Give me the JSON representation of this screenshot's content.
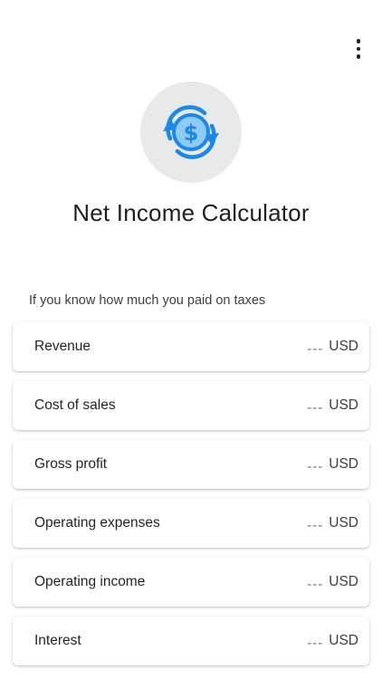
{
  "colors": {
    "accent": "#1e88e5",
    "accent_light": "#90caf9",
    "logo_background": "#e8e9ea"
  },
  "header": {
    "menu_icon": "more-vert-icon",
    "logo_icon": "dollar-cycle-icon",
    "title": "Net Income Calculator"
  },
  "section": {
    "caption": "If you know how much you paid on taxes"
  },
  "rows": [
    {
      "label": "Revenue",
      "value": "---",
      "unit": "USD"
    },
    {
      "label": "Cost of sales",
      "value": "---",
      "unit": "USD"
    },
    {
      "label": "Gross profit",
      "value": "---",
      "unit": "USD"
    },
    {
      "label": "Operating expenses",
      "value": "---",
      "unit": "USD"
    },
    {
      "label": "Operating income",
      "value": "---",
      "unit": "USD"
    },
    {
      "label": "Interest",
      "value": "---",
      "unit": "USD"
    }
  ]
}
